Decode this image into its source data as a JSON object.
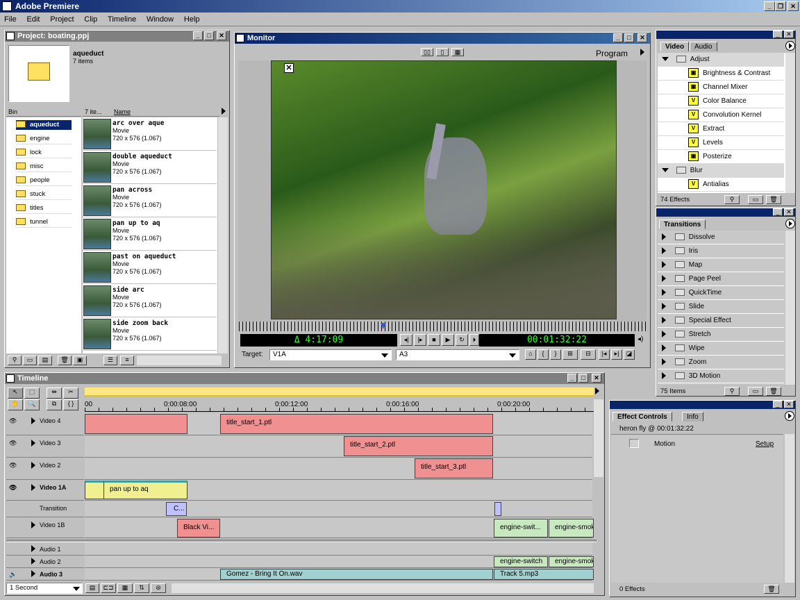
{
  "app": {
    "title": "Adobe Premiere"
  },
  "menu": [
    "File",
    "Edit",
    "Project",
    "Clip",
    "Timeline",
    "Window",
    "Help"
  ],
  "project": {
    "title": "Project: boating.ppj",
    "bin_name": "aqueduct",
    "bin_count": "7 items",
    "col_bin": "Bin",
    "col_items": "7 ite...",
    "col_name": "Name",
    "bins": [
      "aqueduct",
      "engine",
      "lock",
      "misc",
      "people",
      "stuck",
      "titles",
      "tunnel"
    ],
    "clips": [
      {
        "name": "arc over aque",
        "type": "Movie",
        "dims": "720 x 576 (1.067)"
      },
      {
        "name": "double aqueduct",
        "type": "Movie",
        "dims": "720 x 576 (1.067)"
      },
      {
        "name": "pan across",
        "type": "Movie",
        "dims": "720 x 576 (1.067)"
      },
      {
        "name": "pan up to aq",
        "type": "Movie",
        "dims": "720 x 576 (1.067)"
      },
      {
        "name": "past on aqueduct",
        "type": "Movie",
        "dims": "720 x 576 (1.067)"
      },
      {
        "name": "side arc",
        "type": "Movie",
        "dims": "720 x 576 (1.067)"
      },
      {
        "name": "side zoom back",
        "type": "Movie",
        "dims": "720 x 576 (1.067)"
      }
    ]
  },
  "monitor": {
    "title": "Monitor",
    "view": "Program",
    "duration": "Δ 4:17:09",
    "timecode": "00:01:32:22",
    "target_label": "Target:",
    "target_video": "V1A",
    "target_audio": "A3"
  },
  "effects": {
    "tab_video": "Video",
    "tab_audio": "Audio",
    "items": [
      {
        "kind": "folder",
        "label": "Adjust",
        "open": true
      },
      {
        "kind": "effect",
        "label": "Brightness & Contrast"
      },
      {
        "kind": "effect",
        "label": "Channel Mixer"
      },
      {
        "kind": "effect",
        "label": "Color Balance"
      },
      {
        "kind": "effect",
        "label": "Convolution Kernel"
      },
      {
        "kind": "effect",
        "label": "Extract"
      },
      {
        "kind": "effect",
        "label": "Levels"
      },
      {
        "kind": "effect",
        "label": "Posterize"
      },
      {
        "kind": "folder",
        "label": "Blur",
        "open": true
      },
      {
        "kind": "effect",
        "label": "Antialias"
      }
    ],
    "count": "74 Effects"
  },
  "transitions": {
    "tab": "Transitions",
    "items": [
      "Dissolve",
      "Iris",
      "Map",
      "Page Peel",
      "QuickTime",
      "Slide",
      "Special Effect",
      "Stretch",
      "Wipe",
      "Zoom",
      "3D Motion"
    ],
    "count": "75 Items"
  },
  "effect_controls": {
    "tab": "Effect Controls",
    "tab_info": "Info",
    "clip": "heron fly @ 00:01:32:22",
    "motion": "Motion",
    "setup": "Setup",
    "count": "0 Effects"
  },
  "timeline": {
    "title": "Timeline",
    "ruler": [
      "00",
      "0:00:08:00",
      "0:00:12:00",
      "0:00:16:00",
      "0:00:20:00"
    ],
    "tracks": {
      "v4": "Video 4",
      "v3": "Video 3",
      "v2": "Video 2",
      "v1a": "Video 1A",
      "trans": "Transition",
      "v1b": "Video 1B",
      "a1": "Audio 1",
      "a2": "Audio 2",
      "a3": "Audio 3"
    },
    "clips": {
      "t1": "title_start_1.ptl",
      "t2": "title_start_2.ptl",
      "t3": "title_start_3.ptl",
      "pan": "pan up to aq",
      "trans_c": "C...",
      "black": "Black Vi...",
      "eng_sw": "engine-swit...",
      "eng_sm": "engine-smok",
      "a2_sw": "engine-switch",
      "a2_sm": "engine-smok",
      "gomez": "Gomez - Bring It On.wav",
      "track5": "Track 5.mp3"
    },
    "zoom": "1 Second"
  }
}
